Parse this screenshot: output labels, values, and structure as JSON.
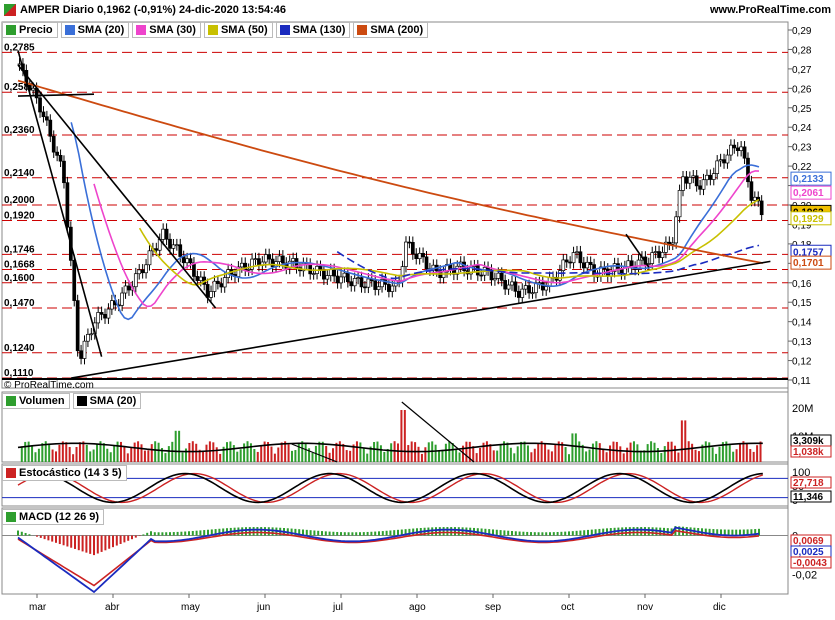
{
  "header": {
    "title": "AMPER Diario 0,1962 (-0,91%) 24-dic-2020 13:54:46",
    "site": "www.ProRealTime.com",
    "watermark": "© ProRealTime.com"
  },
  "colors": {
    "up": "#2e9e2e",
    "down": "#cc2222",
    "sma20": "#3a6fd8",
    "sma30": "#ee44cc",
    "sma50": "#c8c000",
    "sma130": "#1a2bbf",
    "sma200": "#cc4a10",
    "hline": "#cc0000"
  },
  "legends": {
    "price": [
      {
        "label": "Precio",
        "color": "#2e9e2e"
      },
      {
        "label": "SMA (20)",
        "color": "#3a6fd8"
      },
      {
        "label": "SMA (30)",
        "color": "#ee44cc"
      },
      {
        "label": "SMA (50)",
        "color": "#c8c000"
      },
      {
        "label": "SMA (130)",
        "color": "#1a2bbf"
      },
      {
        "label": "SMA (200)",
        "color": "#cc4a10"
      }
    ],
    "volume": [
      {
        "label": "Volumen",
        "color": "#2e9e2e"
      },
      {
        "label": "SMA (20)",
        "color": "#000000"
      }
    ],
    "stochastic": [
      {
        "label": "Estocástico (14 3 5)",
        "color": "#cc2222"
      }
    ],
    "macd": [
      {
        "label": "MACD (12 26 9)",
        "color": "#2e9e2e"
      }
    ]
  },
  "chart_data": [
    {
      "type": "candlestick",
      "title": "AMPER Diario",
      "x_months": [
        "mar",
        "abr",
        "may",
        "jun",
        "jul",
        "ago",
        "sep",
        "oct",
        "nov",
        "dic"
      ],
      "y_ticks": [
        "0,29",
        "0,28",
        "0,27",
        "0,26",
        "0,25",
        "0,24",
        "0,23",
        "0,22",
        "0,21",
        "0,20",
        "0,19",
        "0,18",
        "0,17",
        "0,16",
        "0,15",
        "0,14",
        "0,13",
        "0,12",
        "0,11"
      ],
      "ylim": [
        0.11,
        0.29
      ],
      "horizontal_levels": [
        "0,2785",
        "0,2580",
        "0,2360",
        "0,2140",
        "0,2000",
        "0,1920",
        "0,1746",
        "0,1668",
        "0,1600",
        "0,1470",
        "0,1240",
        "0,1110"
      ],
      "last_values": [
        {
          "label": "0,2133",
          "color": "#3a6fd8"
        },
        {
          "label": "0,2061",
          "color": "#ee44cc"
        },
        {
          "label": "0,1962",
          "color": "#000000"
        },
        {
          "label": "0,1929",
          "color": "#c8c000"
        },
        {
          "label": "0,1757",
          "color": "#1a2bbf"
        },
        {
          "label": "0,1701",
          "color": "#cc4a10"
        }
      ],
      "close_path": [
        {
          "m": 0,
          "v": 0.272
        },
        {
          "m": 0.3,
          "v": 0.25
        },
        {
          "m": 0.6,
          "v": 0.215
        },
        {
          "m": 0.8,
          "v": 0.12
        },
        {
          "m": 1.0,
          "v": 0.14
        },
        {
          "m": 1.3,
          "v": 0.15
        },
        {
          "m": 1.6,
          "v": 0.165
        },
        {
          "m": 1.9,
          "v": 0.185
        },
        {
          "m": 2.2,
          "v": 0.172
        },
        {
          "m": 2.5,
          "v": 0.155
        },
        {
          "m": 2.8,
          "v": 0.165
        },
        {
          "m": 3.2,
          "v": 0.172
        },
        {
          "m": 3.6,
          "v": 0.17
        },
        {
          "m": 4.0,
          "v": 0.165
        },
        {
          "m": 4.5,
          "v": 0.16
        },
        {
          "m": 5.0,
          "v": 0.158
        },
        {
          "m": 5.1,
          "v": 0.18
        },
        {
          "m": 5.5,
          "v": 0.165
        },
        {
          "m": 5.8,
          "v": 0.168
        },
        {
          "m": 6.2,
          "v": 0.165
        },
        {
          "m": 6.6,
          "v": 0.155
        },
        {
          "m": 7.0,
          "v": 0.16
        },
        {
          "m": 7.3,
          "v": 0.175
        },
        {
          "m": 7.6,
          "v": 0.165
        },
        {
          "m": 8.0,
          "v": 0.168
        },
        {
          "m": 8.3,
          "v": 0.172
        },
        {
          "m": 8.6,
          "v": 0.18
        },
        {
          "m": 8.75,
          "v": 0.215
        },
        {
          "m": 9.0,
          "v": 0.21
        },
        {
          "m": 9.3,
          "v": 0.225
        },
        {
          "m": 9.5,
          "v": 0.232
        },
        {
          "m": 9.65,
          "v": 0.205
        },
        {
          "m": 9.8,
          "v": 0.1962
        }
      ]
    },
    {
      "type": "bar",
      "title": "Volumen",
      "y_ticks": [
        "20M",
        "10M"
      ],
      "last_values": [
        {
          "label": "3,309k",
          "color": "#000000"
        },
        {
          "label": "1,038k",
          "color": "#cc2222"
        }
      ]
    },
    {
      "type": "line",
      "title": "Estocástico (14 3 5)",
      "y_ticks": [
        "100",
        "50",
        "0"
      ],
      "last_values": [
        {
          "label": "27,718",
          "color": "#cc2222"
        },
        {
          "label": "11,346",
          "color": "#000000"
        }
      ]
    },
    {
      "type": "line",
      "title": "MACD (12 26 9)",
      "y_ticks": [
        "0",
        "-0,02"
      ],
      "last_values": [
        {
          "label": "0,0069",
          "color": "#cc2222"
        },
        {
          "label": "0,0025",
          "color": "#1a2bbf"
        },
        {
          "label": "-0,0043",
          "color": "#cc2222"
        }
      ]
    }
  ]
}
